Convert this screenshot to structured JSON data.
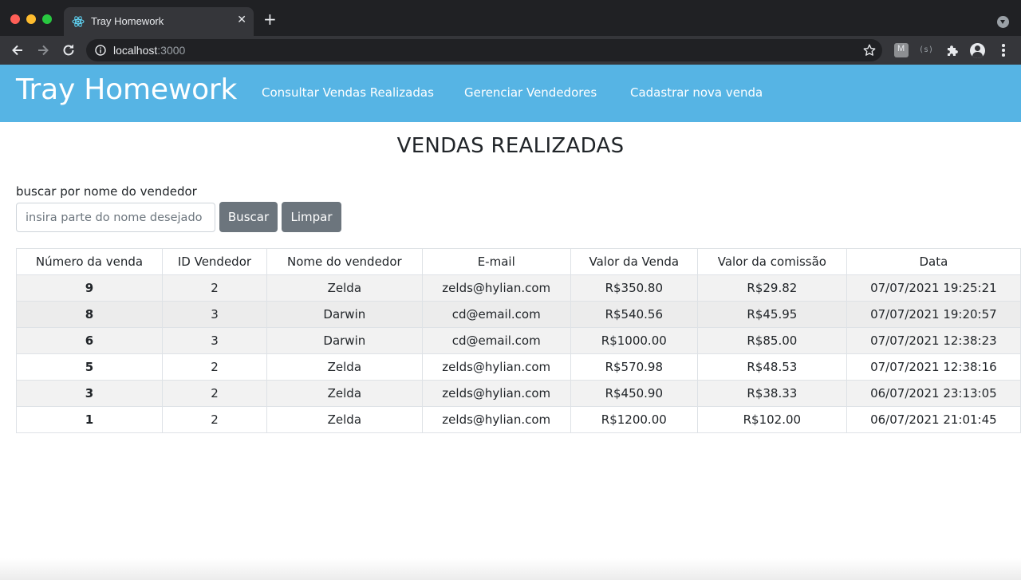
{
  "browser": {
    "tab_title": "Tray Homework",
    "tab_close": "✕",
    "new_tab": "+",
    "url_host": "localhost",
    "url_port": ":3000",
    "extension_m_label": "M",
    "extension_s_label": "(s)",
    "icons": [
      "react-favicon-icon",
      "back-arrow-icon",
      "forward-arrow-icon",
      "reload-icon",
      "info-icon",
      "star-icon",
      "puzzle-extensions-icon",
      "profile-avatar-icon",
      "more-menu-icon",
      "tab-search-icon"
    ]
  },
  "navbar": {
    "brand": "Tray Homework",
    "links": [
      "Consultar Vendas Realizadas",
      "Gerenciar Vendedores",
      "Cadastrar nova venda"
    ],
    "background": "#56b4e4"
  },
  "main": {
    "title": "VENDAS REALIZADAS",
    "search": {
      "label": "buscar por nome do vendedor",
      "placeholder": "insira parte do nome desejado",
      "value": "",
      "search_button": "Buscar",
      "clear_button": "Limpar"
    },
    "table": {
      "headers": [
        "Número da venda",
        "ID Vendedor",
        "Nome do vendedor",
        "E-mail",
        "Valor da Venda",
        "Valor da comissão",
        "Data"
      ],
      "rows": [
        [
          "9",
          "2",
          "Zelda",
          "zelds@hylian.com",
          "R$350.80",
          "R$29.82",
          "07/07/2021 19:25:21"
        ],
        [
          "8",
          "3",
          "Darwin",
          "cd@email.com",
          "R$540.56",
          "R$45.95",
          "07/07/2021 19:20:57"
        ],
        [
          "6",
          "3",
          "Darwin",
          "cd@email.com",
          "R$1000.00",
          "R$85.00",
          "07/07/2021 12:38:23"
        ],
        [
          "5",
          "2",
          "Zelda",
          "zelds@hylian.com",
          "R$570.98",
          "R$48.53",
          "07/07/2021 12:38:16"
        ],
        [
          "3",
          "2",
          "Zelda",
          "zelds@hylian.com",
          "R$450.90",
          "R$38.33",
          "06/07/2021 23:13:05"
        ],
        [
          "1",
          "2",
          "Zelda",
          "zelds@hylian.com",
          "R$1200.00",
          "R$102.00",
          "06/07/2021 21:01:45"
        ]
      ]
    }
  }
}
